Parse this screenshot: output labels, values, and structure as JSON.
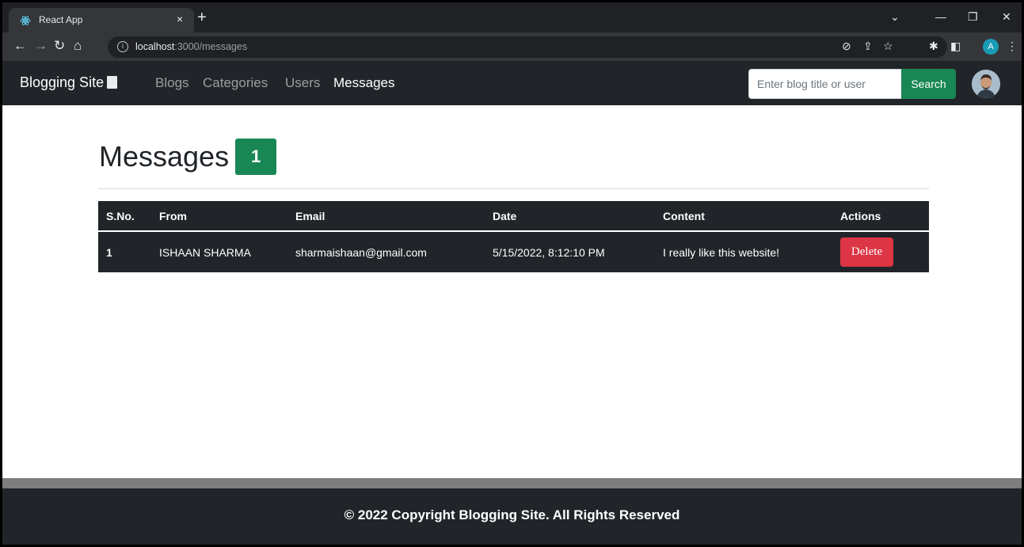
{
  "browser": {
    "tab_title": "React App",
    "tab_close": "×",
    "new_tab": "+",
    "url_host": "localhost",
    "url_rest": ":3000/messages",
    "profile_initial": "A"
  },
  "navbar": {
    "brand": "Blogging Site",
    "links": [
      "Blogs",
      "Categories",
      "Users",
      "Messages"
    ],
    "active_link": "Messages",
    "search_placeholder": "Enter blog title or user",
    "search_button": "Search"
  },
  "page": {
    "title": "Messages",
    "count": "1"
  },
  "table": {
    "headers": [
      "S.No.",
      "From",
      "Email",
      "Date",
      "Content",
      "Actions"
    ],
    "rows": [
      {
        "sno": "1",
        "from": "ISHAAN SHARMA",
        "email": "sharmaishaan@gmail.com",
        "date": "5/15/2022, 8:12:10 PM",
        "content": "I really like this website!",
        "action": "Delete"
      }
    ]
  },
  "footer": {
    "text": "© 2022 Copyright Blogging Site. All Rights Reserved"
  },
  "colors": {
    "navbar_bg": "#212529",
    "success": "#198754",
    "danger": "#dc3545"
  }
}
